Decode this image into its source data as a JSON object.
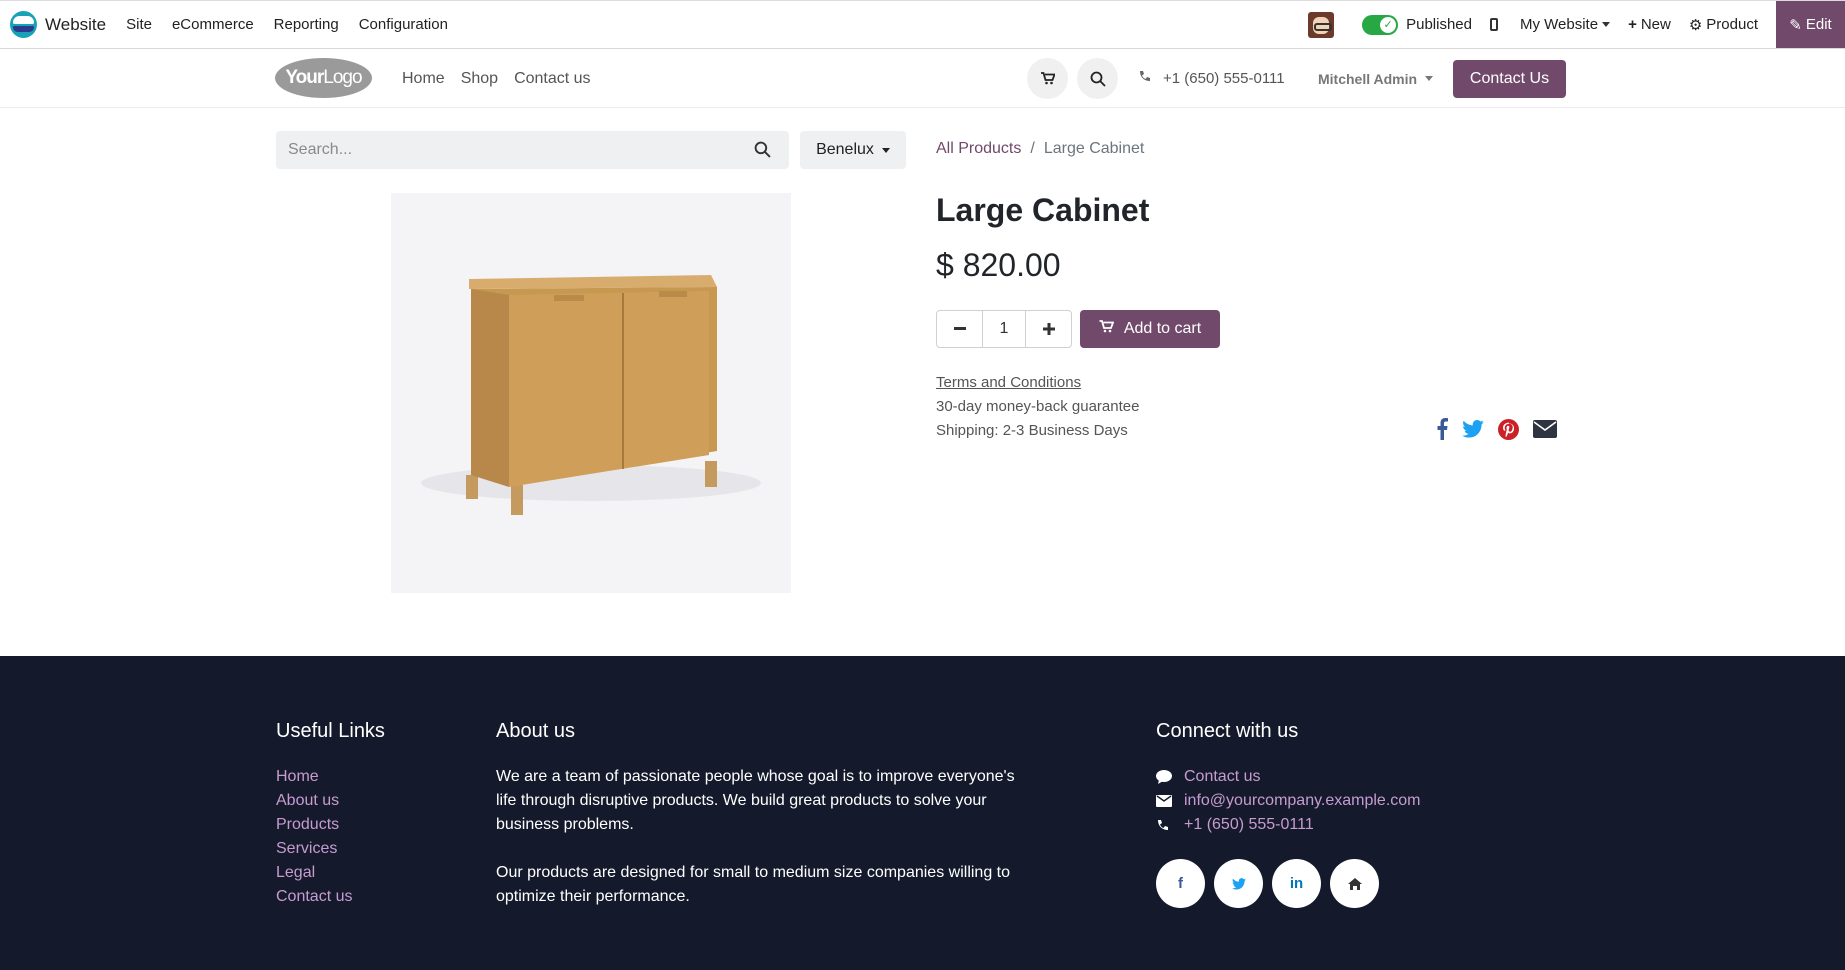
{
  "adminbar": {
    "app_name": "Website",
    "menu": [
      "Site",
      "eCommerce",
      "Reporting",
      "Configuration"
    ],
    "published_label": "Published",
    "website_switcher": "My Website",
    "new_label": "New",
    "product_label": "Product",
    "edit_label": "Edit"
  },
  "header": {
    "logo_text_bold": "Your",
    "logo_text": "Logo",
    "nav": [
      "Home",
      "Shop",
      "Contact us"
    ],
    "phone": "+1 (650) 555-0111",
    "user": "Mitchell Admin",
    "contact_button": "Contact Us"
  },
  "product_page": {
    "search_placeholder": "Search...",
    "pricelist": "Benelux",
    "breadcrumb": {
      "parent": "All Products",
      "current": "Large Cabinet"
    },
    "title": "Large Cabinet",
    "price": "$ 820.00",
    "quantity": "1",
    "add_to_cart": "Add to cart",
    "terms": "Terms and Conditions",
    "guarantee": "30-day money-back guarantee",
    "shipping": "Shipping: 2-3 Business Days",
    "share_icons": [
      "facebook-icon",
      "twitter-icon",
      "pinterest-icon",
      "envelope-icon"
    ]
  },
  "footer": {
    "useful_links_title": "Useful Links",
    "useful_links": [
      "Home",
      "About us",
      "Products",
      "Services",
      "Legal",
      "Contact us"
    ],
    "about_title": "About us",
    "about_p1": "We are a team of passionate people whose goal is to improve everyone's life through disruptive products. We build great products to solve your business problems.",
    "about_p2": "Our products are designed for small to medium size companies willing to optimize their performance.",
    "connect_title": "Connect with us",
    "contact_link": "Contact us",
    "email": "info@yourcompany.example.com",
    "phone": "+1 (650) 555-0111",
    "social_icons": [
      "facebook-icon",
      "twitter-icon",
      "linkedin-icon",
      "home-icon"
    ]
  },
  "colors": {
    "brand": "#71496b",
    "footer_bg": "#141a2b",
    "footer_link": "#c79bd0",
    "published_green": "#28a745"
  }
}
